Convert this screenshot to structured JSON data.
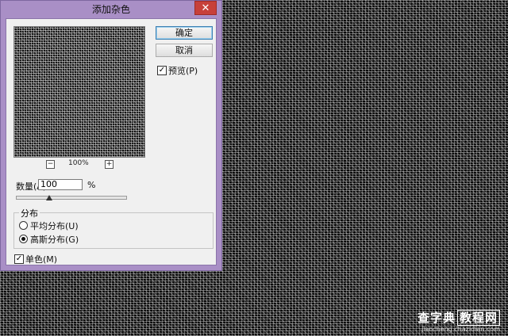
{
  "dialog": {
    "title": "添加杂色",
    "close_label": "✕",
    "buttons": {
      "ok": "确定",
      "cancel": "取消"
    },
    "preview_checkbox": {
      "label": "预览(P)",
      "checked": true
    },
    "zoom": {
      "minus": "−",
      "plus": "+",
      "value": "100%"
    },
    "amount": {
      "label": "数量(A):",
      "value": "100",
      "unit": "%",
      "slider_fraction": 0.3
    },
    "distribution": {
      "title": "分布",
      "options": [
        {
          "label": "平均分布(U)",
          "selected": false
        },
        {
          "label": "高斯分布(G)",
          "selected": true
        }
      ]
    },
    "mono_checkbox": {
      "label": "单色(M)",
      "checked": true
    }
  },
  "watermark": {
    "main_a": "查字典",
    "main_b": "教程网",
    "sub": "jiaocheng.chazidian.com"
  }
}
